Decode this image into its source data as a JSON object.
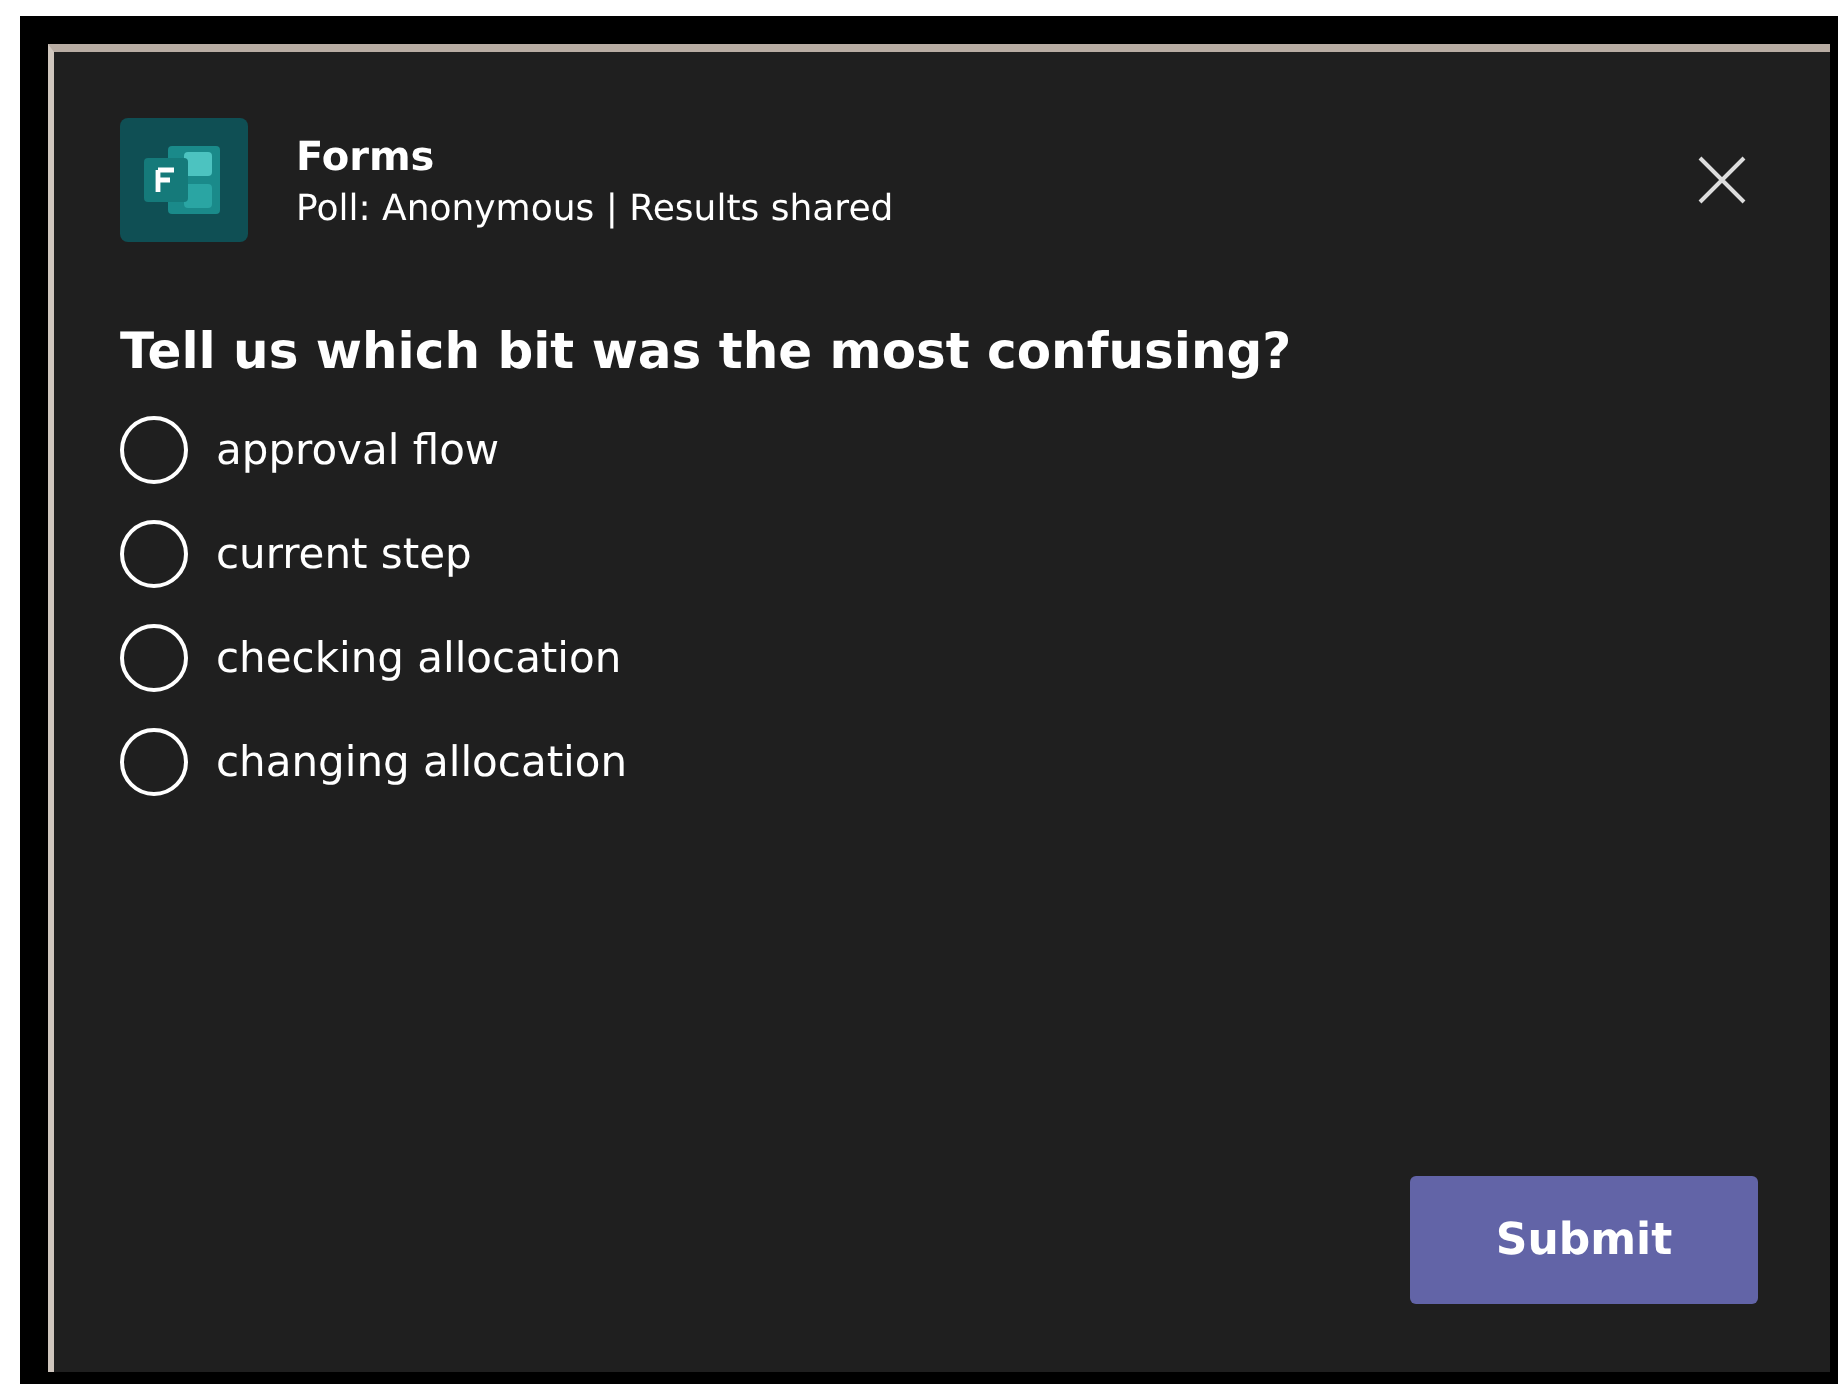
{
  "header": {
    "app_name": "Forms",
    "subtitle": "Poll: Anonymous | Results shared"
  },
  "question": "Tell us which bit was the most confusing?",
  "options": [
    {
      "label": "approval flow",
      "selected": false
    },
    {
      "label": "current step",
      "selected": false
    },
    {
      "label": "checking allocation",
      "selected": false
    },
    {
      "label": "changing allocation",
      "selected": false
    }
  ],
  "submit_button": "Submit"
}
